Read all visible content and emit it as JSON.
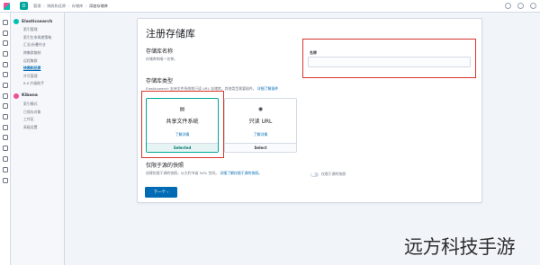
{
  "breadcrumbs": [
    "管理",
    "快照和还原",
    "存储库",
    "添加存储库"
  ],
  "nav": {
    "elasticsearch": {
      "title": "Elasticsearch",
      "items": [
        "索引管理",
        "索引生命周期策略",
        "汇总/折叠作业",
        "跨集群复制",
        "远程集群",
        "快照和还原",
        "许可管理",
        "8.0 升级助手"
      ],
      "active_index": 5
    },
    "kibana": {
      "title": "Kibana",
      "items": [
        "索引模式",
        "已保存对象",
        "工作区",
        "高级设置"
      ]
    }
  },
  "page": {
    "title": "注册存储库",
    "name_section_title": "存储库名称",
    "name_section_desc": "存储库的唯一名称。",
    "name_label": "名称",
    "name_value": "",
    "type_section_title": "存储库类型",
    "type_section_desc": "Elasticsearch 支持文件系统和只读 URL 存储库。其他类型需要插件。",
    "type_section_link": "详细了解插件",
    "cards": [
      {
        "icon": "file-system-icon",
        "title": "共享文件系统",
        "link": "了解详情",
        "footer": "Selected"
      },
      {
        "icon": "eye-icon",
        "title": "只读 URL",
        "link": "了解详情",
        "footer": "Select"
      }
    ],
    "source_section_title": "仅限于源的快照",
    "source_section_desc": "创建仅限于源的快照，以大约节省 50% 空间。",
    "source_section_link": "详细了解仅限于源的快照。",
    "toggle_label": "仅限于源的快照",
    "next_button": "下一个 ›"
  },
  "watermark": "远方科技手游",
  "colors": {
    "accent": "#006bb4",
    "selected": "#00a69b",
    "highlight": "#d9342b"
  }
}
